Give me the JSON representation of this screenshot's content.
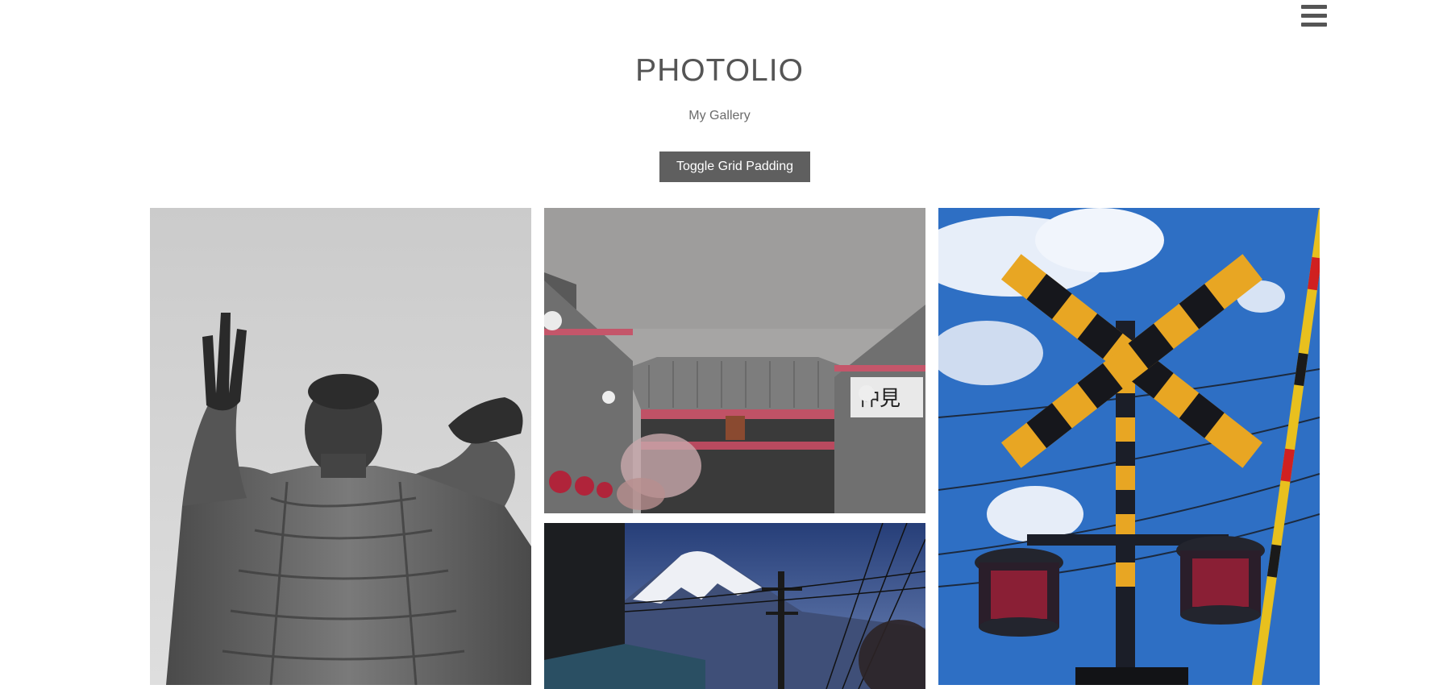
{
  "header": {
    "title": "PHOTOLIO",
    "subtitle": "My Gallery",
    "toggle_label": "Toggle Grid Padding",
    "menu_icon": "hamburger-menu-icon"
  },
  "gallery": {
    "photos": [
      {
        "subject": "buddha-statue",
        "colors": [
          "#cfcfcf",
          "#3a3a3a"
        ]
      },
      {
        "subject": "temple-gate",
        "colors": [
          "#a5a5a5",
          "#b33a4e"
        ]
      },
      {
        "subject": "mount-fuji",
        "colors": [
          "#2d4f8c",
          "#1a1a1a"
        ]
      },
      {
        "subject": "railroad-crossing",
        "colors": [
          "#2f6fc4",
          "#e8a623"
        ]
      }
    ]
  }
}
